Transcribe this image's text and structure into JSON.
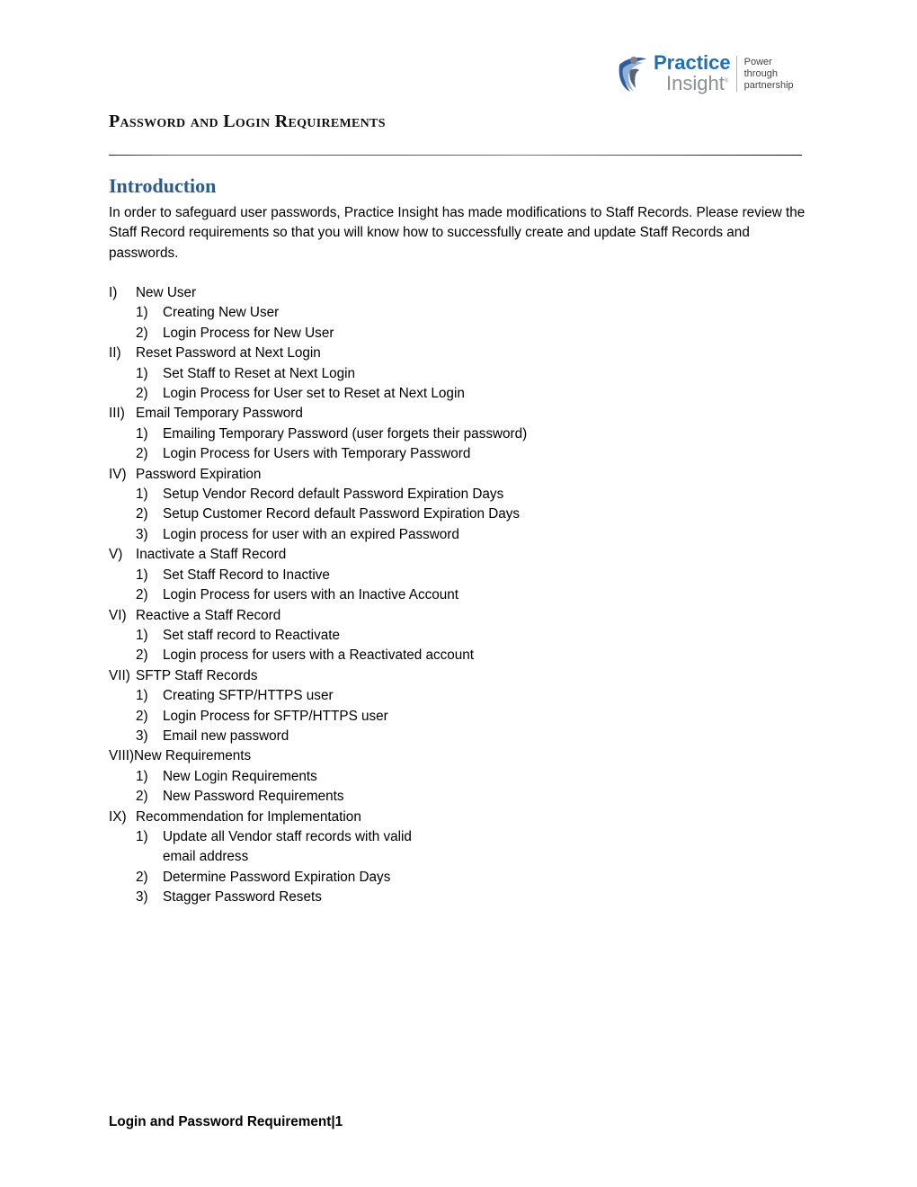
{
  "header": {
    "logo": {
      "icon": "practice-insight-logo-mark",
      "word1": "Practice",
      "word2": "Insight",
      "registered": "®",
      "tagline": [
        "Power",
        "through",
        "partnership"
      ],
      "colors": {
        "primary": "#1f6fb3",
        "secondary": "#8a8f95"
      }
    }
  },
  "document": {
    "title": "Password and Login Requirements",
    "intro": {
      "heading": "Introduction",
      "heading_color": "#2b5a8c",
      "body": "In order to safeguard user passwords, Practice Insight has made modifications to Staff Records. Please review the Staff Record requirements so that you will know how to successfully create and update Staff Records and passwords."
    },
    "outline": [
      {
        "num": "I)",
        "title": "New User",
        "items": [
          {
            "num": "1)",
            "text": "Creating New User"
          },
          {
            "num": "2)",
            "text": "Login Process for New User"
          }
        ]
      },
      {
        "num": "II)",
        "title": "Reset Password at Next Login",
        "items": [
          {
            "num": "1)",
            "text": "Set Staff to Reset at Next Login"
          },
          {
            "num": "2)",
            "text": "Login Process for User set to Reset at Next Login"
          }
        ]
      },
      {
        "num": "III)",
        "title": "Email Temporary Password",
        "items": [
          {
            "num": "1)",
            "text": "Emailing Temporary Password (user forgets their password)"
          },
          {
            "num": "2)",
            "text": "Login Process for Users with Temporary Password"
          }
        ]
      },
      {
        "num": "IV)",
        "title": "Password Expiration",
        "items": [
          {
            "num": "1)",
            "text": "Setup Vendor Record default Password Expiration Days"
          },
          {
            "num": "2)",
            "text": "Setup Customer Record default Password Expiration Days"
          },
          {
            "num": "3)",
            "text": "Login process for user with an expired Password"
          }
        ]
      },
      {
        "num": "V)",
        "title": "Inactivate a Staff Record",
        "items": [
          {
            "num": "1)",
            "text": "Set Staff Record to Inactive"
          },
          {
            "num": "2)",
            "text": "Login Process for users with an Inactive Account"
          }
        ]
      },
      {
        "num": "VI)",
        "title": "Reactive a Staff Record",
        "items": [
          {
            "num": "1)",
            "text": "Set staff record to Reactivate"
          },
          {
            "num": "2)",
            "text": "Login process for users with a Reactivated account"
          }
        ]
      },
      {
        "num": "VII)",
        "title": "SFTP Staff Records",
        "items": [
          {
            "num": "1)",
            "text": "Creating SFTP/HTTPS user"
          },
          {
            "num": "2)",
            "text": "Login Process for SFTP/HTTPS user"
          },
          {
            "num": "3)",
            "text": "Email new password"
          }
        ]
      },
      {
        "num": "VIII)",
        "title": "New Requirements",
        "items": [
          {
            "num": "1)",
            "text": "New Login Requirements"
          },
          {
            "num": "2)",
            "text": "New Password Requirements"
          }
        ]
      },
      {
        "num": "IX)",
        "title": "Recommendation for Implementation",
        "items": [
          {
            "num": "1)",
            "text": "Update all Vendor staff records with valid email address"
          },
          {
            "num": "2)",
            "text": "Determine Password Expiration Days"
          },
          {
            "num": "3)",
            "text": "Stagger Password Resets"
          }
        ]
      }
    ]
  },
  "footer": {
    "label": "Login and Password Requirement",
    "separator": "|",
    "page_number": "1"
  }
}
